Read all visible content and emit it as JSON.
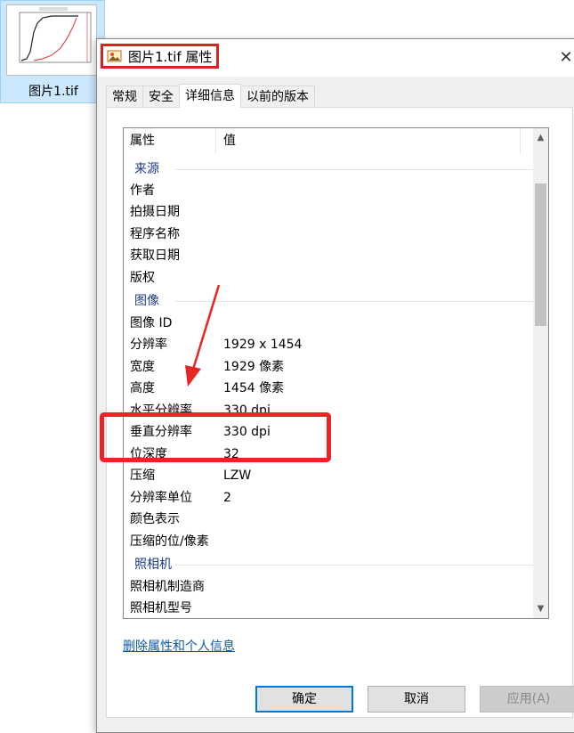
{
  "desktop": {
    "file_label": "图片1.tif",
    "thumbnail": {
      "legend_a": "— red",
      "legend_b": "— red2"
    }
  },
  "dialog": {
    "title": "图片1.tif 属性",
    "tabs": [
      {
        "label": "常规"
      },
      {
        "label": "安全"
      },
      {
        "label": "详细信息"
      },
      {
        "label": "以前的版本"
      }
    ],
    "columns": {
      "property": "属性",
      "value": "值"
    },
    "groups": {
      "source": "来源",
      "image": "图像",
      "camera": "照相机"
    },
    "rows": [
      {
        "key": "作者",
        "value": ""
      },
      {
        "key": "拍摄日期",
        "value": ""
      },
      {
        "key": "程序名称",
        "value": ""
      },
      {
        "key": "获取日期",
        "value": ""
      },
      {
        "key": "版权",
        "value": ""
      },
      {
        "key": "图像 ID",
        "value": ""
      },
      {
        "key": "分辨率",
        "value": "1929 x 1454"
      },
      {
        "key": "宽度",
        "value": "1929 像素"
      },
      {
        "key": "高度",
        "value": "1454 像素"
      },
      {
        "key": "水平分辨率",
        "value": "330 dpi"
      },
      {
        "key": "垂直分辨率",
        "value": "330 dpi"
      },
      {
        "key": "位深度",
        "value": "32"
      },
      {
        "key": "压缩",
        "value": "LZW"
      },
      {
        "key": "分辨率单位",
        "value": "2"
      },
      {
        "key": "颜色表示",
        "value": ""
      },
      {
        "key": "压缩的位/像素",
        "value": ""
      },
      {
        "key": "照相机制造商",
        "value": ""
      },
      {
        "key": "照相机型号",
        "value": ""
      }
    ],
    "remove_link": "删除属性和个人信息",
    "buttons": {
      "ok": "确定",
      "cancel": "取消",
      "apply": "应用(A)"
    },
    "annotation_color": "#e82424"
  }
}
